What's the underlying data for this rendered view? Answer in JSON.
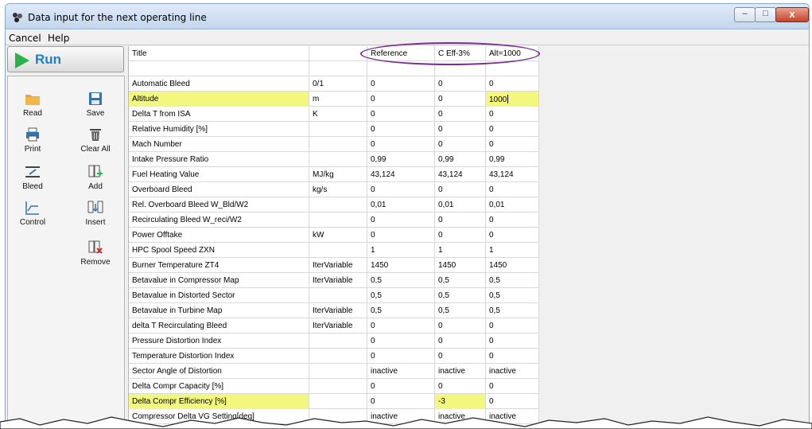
{
  "window": {
    "title": "Data input for the next operating line"
  },
  "window_controls": {
    "minimize": "–",
    "maximize": "□",
    "close": "x"
  },
  "menu": {
    "cancel": "Cancel",
    "help": "Help"
  },
  "run_button": {
    "label": "Run"
  },
  "tools": {
    "read": "Read",
    "save": "Save",
    "print": "Print",
    "clear_all": "Clear All",
    "bleed": "Bleed",
    "add": "Add",
    "control": "Control",
    "insert": "Insert",
    "remove": "Remove"
  },
  "table": {
    "header": {
      "name": "Title",
      "unit": "",
      "ref": "Reference",
      "ceff": "C Eff-3%",
      "alt": "Alt=1000"
    },
    "rows": [
      {
        "name": "",
        "unit": "",
        "ref": "",
        "ceff": "",
        "alt": ""
      },
      {
        "name": "Automatic Bleed",
        "unit": "0/1",
        "ref": "0",
        "ceff": "0",
        "alt": "0"
      },
      {
        "name": "Altitude",
        "unit": "m",
        "ref": "0",
        "ceff": "0",
        "alt": "1000"
      },
      {
        "name": "Delta T from ISA",
        "unit": "K",
        "ref": "0",
        "ceff": "0",
        "alt": "0"
      },
      {
        "name": "Relative Humidity [%]",
        "unit": "",
        "ref": "0",
        "ceff": "0",
        "alt": "0"
      },
      {
        "name": "Mach Number",
        "unit": "",
        "ref": "0",
        "ceff": "0",
        "alt": "0"
      },
      {
        "name": "Intake Pressure Ratio",
        "unit": "",
        "ref": "0,99",
        "ceff": "0,99",
        "alt": "0,99"
      },
      {
        "name": "Fuel Heating Value",
        "unit": "MJ/kg",
        "ref": "43,124",
        "ceff": "43,124",
        "alt": "43,124"
      },
      {
        "name": "Overboard Bleed",
        "unit": "kg/s",
        "ref": "0",
        "ceff": "0",
        "alt": "0"
      },
      {
        "name": "Rel. Overboard Bleed W_Bld/W2",
        "unit": "",
        "ref": "0,01",
        "ceff": "0,01",
        "alt": "0,01"
      },
      {
        "name": "Recirculating Bleed W_reci/W2",
        "unit": "",
        "ref": "0",
        "ceff": "0",
        "alt": "0"
      },
      {
        "name": "Power Offtake",
        "unit": "kW",
        "ref": "0",
        "ceff": "0",
        "alt": "0"
      },
      {
        "name": "HPC Spool Speed ZXN",
        "unit": "",
        "ref": "1",
        "ceff": "1",
        "alt": "1"
      },
      {
        "name": "Burner Temperature ZT4",
        "unit": "IterVariable",
        "ref": "1450",
        "ceff": "1450",
        "alt": "1450"
      },
      {
        "name": "Betavalue in Compressor Map",
        "unit": "IterVariable",
        "ref": "0,5",
        "ceff": "0,5",
        "alt": "0,5"
      },
      {
        "name": "Betavalue in Distorted Sector",
        "unit": "",
        "ref": "0,5",
        "ceff": "0,5",
        "alt": "0,5"
      },
      {
        "name": "Betavalue in Turbine Map",
        "unit": "IterVariable",
        "ref": "0,5",
        "ceff": "0,5",
        "alt": "0,5"
      },
      {
        "name": "delta T Recirculating Bleed",
        "unit": "IterVariable",
        "ref": "0",
        "ceff": "0",
        "alt": "0"
      },
      {
        "name": "Pressure Distortion Index",
        "unit": "",
        "ref": "0",
        "ceff": "0",
        "alt": "0"
      },
      {
        "name": "Temperature Distortion Index",
        "unit": "",
        "ref": "0",
        "ceff": "0",
        "alt": "0"
      },
      {
        "name": "Sector Angle of Distortion",
        "unit": "",
        "ref": "inactive",
        "ceff": "inactive",
        "alt": "inactive"
      },
      {
        "name": "Delta Compr Capacity [%]",
        "unit": "",
        "ref": "0",
        "ceff": "0",
        "alt": "0"
      },
      {
        "name": "Delta Compr Efficiency [%]",
        "unit": "",
        "ref": "0",
        "ceff": "-3",
        "alt": "0"
      },
      {
        "name": "Compressor Delta VG Setting[deg]",
        "unit": "",
        "ref": "inactive",
        "ceff": "inactive",
        "alt": "inactive"
      }
    ]
  },
  "colors": {
    "highlight": "#f4f77e",
    "annotation": "#7a2d8c",
    "run_arrow": "#2bb24c",
    "run_text": "#1b7fd2"
  }
}
